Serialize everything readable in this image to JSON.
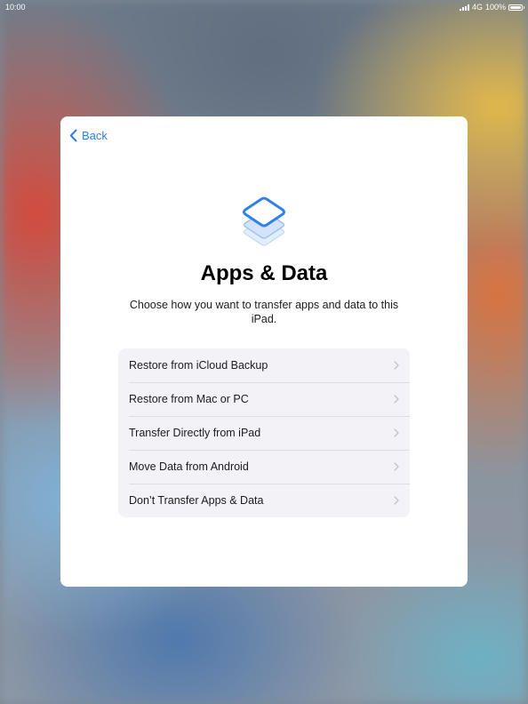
{
  "status_bar": {
    "time": "10:00",
    "network": "4G",
    "battery": "100%",
    "battery_level": 1.0
  },
  "sheet": {
    "back_label": "Back",
    "title": "Apps & Data",
    "subtitle": "Choose how you want to transfer apps and data to this iPad.",
    "options": [
      {
        "label": "Restore from iCloud Backup",
        "icon": "chevron-right-icon"
      },
      {
        "label": "Restore from Mac or PC",
        "icon": "chevron-right-icon"
      },
      {
        "label": "Transfer Directly from iPad",
        "icon": "chevron-right-icon"
      },
      {
        "label": "Move Data from Android",
        "icon": "chevron-right-icon"
      },
      {
        "label": "Don’t Transfer Apps & Data",
        "icon": "chevron-right-icon"
      }
    ]
  },
  "colors": {
    "accent": "#2f7de1",
    "list_background": "#f2f2f7",
    "chevron": "#c4c4c8"
  },
  "icons": {
    "back": "chevron-left-icon",
    "header": "app-data-stack-icon"
  }
}
